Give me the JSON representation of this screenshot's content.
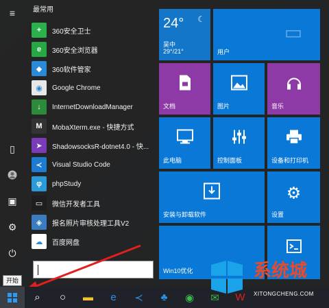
{
  "section_title": "最常用",
  "apps": [
    {
      "label": "360安全卫士",
      "icon": "360-safe-icon",
      "color": "#2bb24c",
      "glyph": "+"
    },
    {
      "label": "360安全浏览器",
      "icon": "360-browser-icon",
      "color": "#27a845",
      "glyph": "e"
    },
    {
      "label": "360软件管家",
      "icon": "360-software-icon",
      "color": "#2b8ad8",
      "glyph": "◆"
    },
    {
      "label": "Google Chrome",
      "icon": "chrome-icon",
      "color": "#e8e8e8",
      "glyph": "◉"
    },
    {
      "label": "InternetDownloadManager",
      "icon": "idm-icon",
      "color": "#2d8a3a",
      "glyph": "↓"
    },
    {
      "label": "MobaXterm.exe - 快捷方式",
      "icon": "mobaxterm-icon",
      "color": "#333",
      "glyph": "M"
    },
    {
      "label": "ShadowsocksR-dotnet4.0 - 快...",
      "icon": "shadowsocks-icon",
      "color": "#7a3bb8",
      "glyph": "➤"
    },
    {
      "label": "Visual Studio Code",
      "icon": "vscode-icon",
      "color": "#1e7bd2",
      "glyph": "≺"
    },
    {
      "label": "phpStudy",
      "icon": "phpstudy-icon",
      "color": "#2a9ad8",
      "glyph": "φ"
    },
    {
      "label": "微信开发者工具",
      "icon": "wechat-devtools-icon",
      "color": "#1e1e1e",
      "glyph": "▭"
    },
    {
      "label": "报名照片审核处理工具V2",
      "icon": "photo-tool-icon",
      "color": "#3a7cc0",
      "glyph": "◈"
    },
    {
      "label": "百度网盘",
      "icon": "baidu-netdisk-icon",
      "color": "#ffffff",
      "glyph": "☁"
    }
  ],
  "weather": {
    "temp": "24°",
    "location": "吴中",
    "range": "29°/21°"
  },
  "tiles": {
    "user": "用户",
    "docs": "文档",
    "pictures": "图片",
    "music": "音乐",
    "this_pc": "此电脑",
    "control_panel": "控制面板",
    "devices": "设备和打印机",
    "install": "安装与卸载软件",
    "settings": "设置",
    "win10": "Win10优化"
  },
  "tooltip": "开始",
  "watermark": {
    "text": "系统城",
    "url": "XITONGCHENG.COM"
  },
  "colors": {
    "tile_blue": "#0a78d7",
    "tile_purple": "#8e3aa6",
    "accent": "#0078d7"
  }
}
